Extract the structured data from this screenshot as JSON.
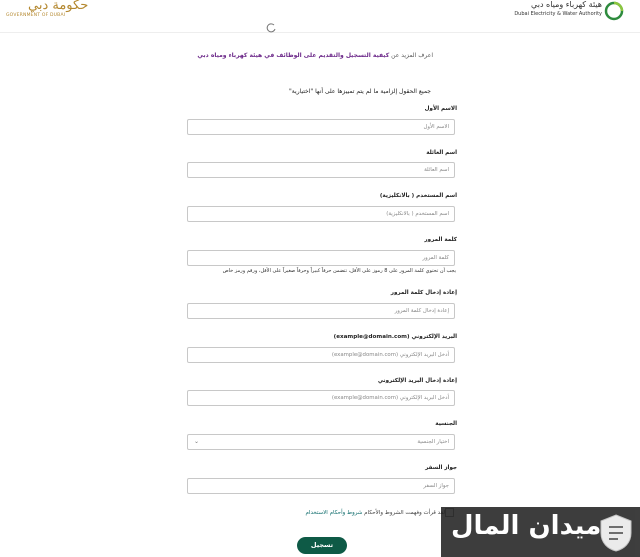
{
  "header": {
    "gov_logo_script": "حكومة دبي",
    "gov_logo_text": "GOVERNMENT OF DUBAI",
    "dewa_ar": "هيئة كهرباء ومياه دبي",
    "dewa_en": "Dubai Electricity & Water Authority"
  },
  "intro": {
    "learn_prefix": "اعرف المزيد عن ",
    "learn_link": "كيفية التسجيل والتقديم على الوظائف في هيئة كهرباء ومياه دبي"
  },
  "form": {
    "required_note": "جميع الحقول إلزامية ما لم يتم تمييزها على أنها \"اختيارية\"",
    "first_name": {
      "label": "الاسم الأول",
      "placeholder": "الاسم الأول"
    },
    "last_name": {
      "label": "اسم العائلة",
      "placeholder": "اسم العائلة"
    },
    "username": {
      "label": "اسم المستخدم ( بالانكليزية)",
      "placeholder": "اسم المستخدم ( بالانكليزية)"
    },
    "password": {
      "label": "كلمة المرور",
      "placeholder": "كلمة المرور",
      "hint": "يجب أن تحتوي كلمة المرور على 8 رموز على الأقل، تتضمن حرفاً كبيراً وحرفاً صغيراً على الأقل، ورقم ورمز خاص"
    },
    "password_confirm": {
      "label": "إعادة إدخال كلمة المرور",
      "placeholder": "إعادة إدخال كلمة المرور"
    },
    "email": {
      "label": "البريد الإلكتروني (example@domain.com)",
      "placeholder": "أدخل البريد الإلكتروني (example@domain.com)"
    },
    "email_confirm": {
      "label": "إعادة إدخال البريد الإلكتروني",
      "placeholder": "أدخل البريد الإلكتروني (example@domain.com)"
    },
    "nationality": {
      "label": "الجنسية",
      "selected": "اختيار الجنسية"
    },
    "passport": {
      "label": "جواز السفر",
      "placeholder": "جواز السفر"
    },
    "terms_prefix": "لقد قرأت وفهمت الشروط والأحكام ",
    "terms_link": "شروط وأحكام الاستخدام",
    "register_label": "تسجيل"
  },
  "watermark": {
    "text": "ميدان المال"
  },
  "colors": {
    "accent": "#6d2a8a",
    "button": "#0e5a46",
    "link": "#0d6b6b",
    "gold": "#b4882f"
  }
}
